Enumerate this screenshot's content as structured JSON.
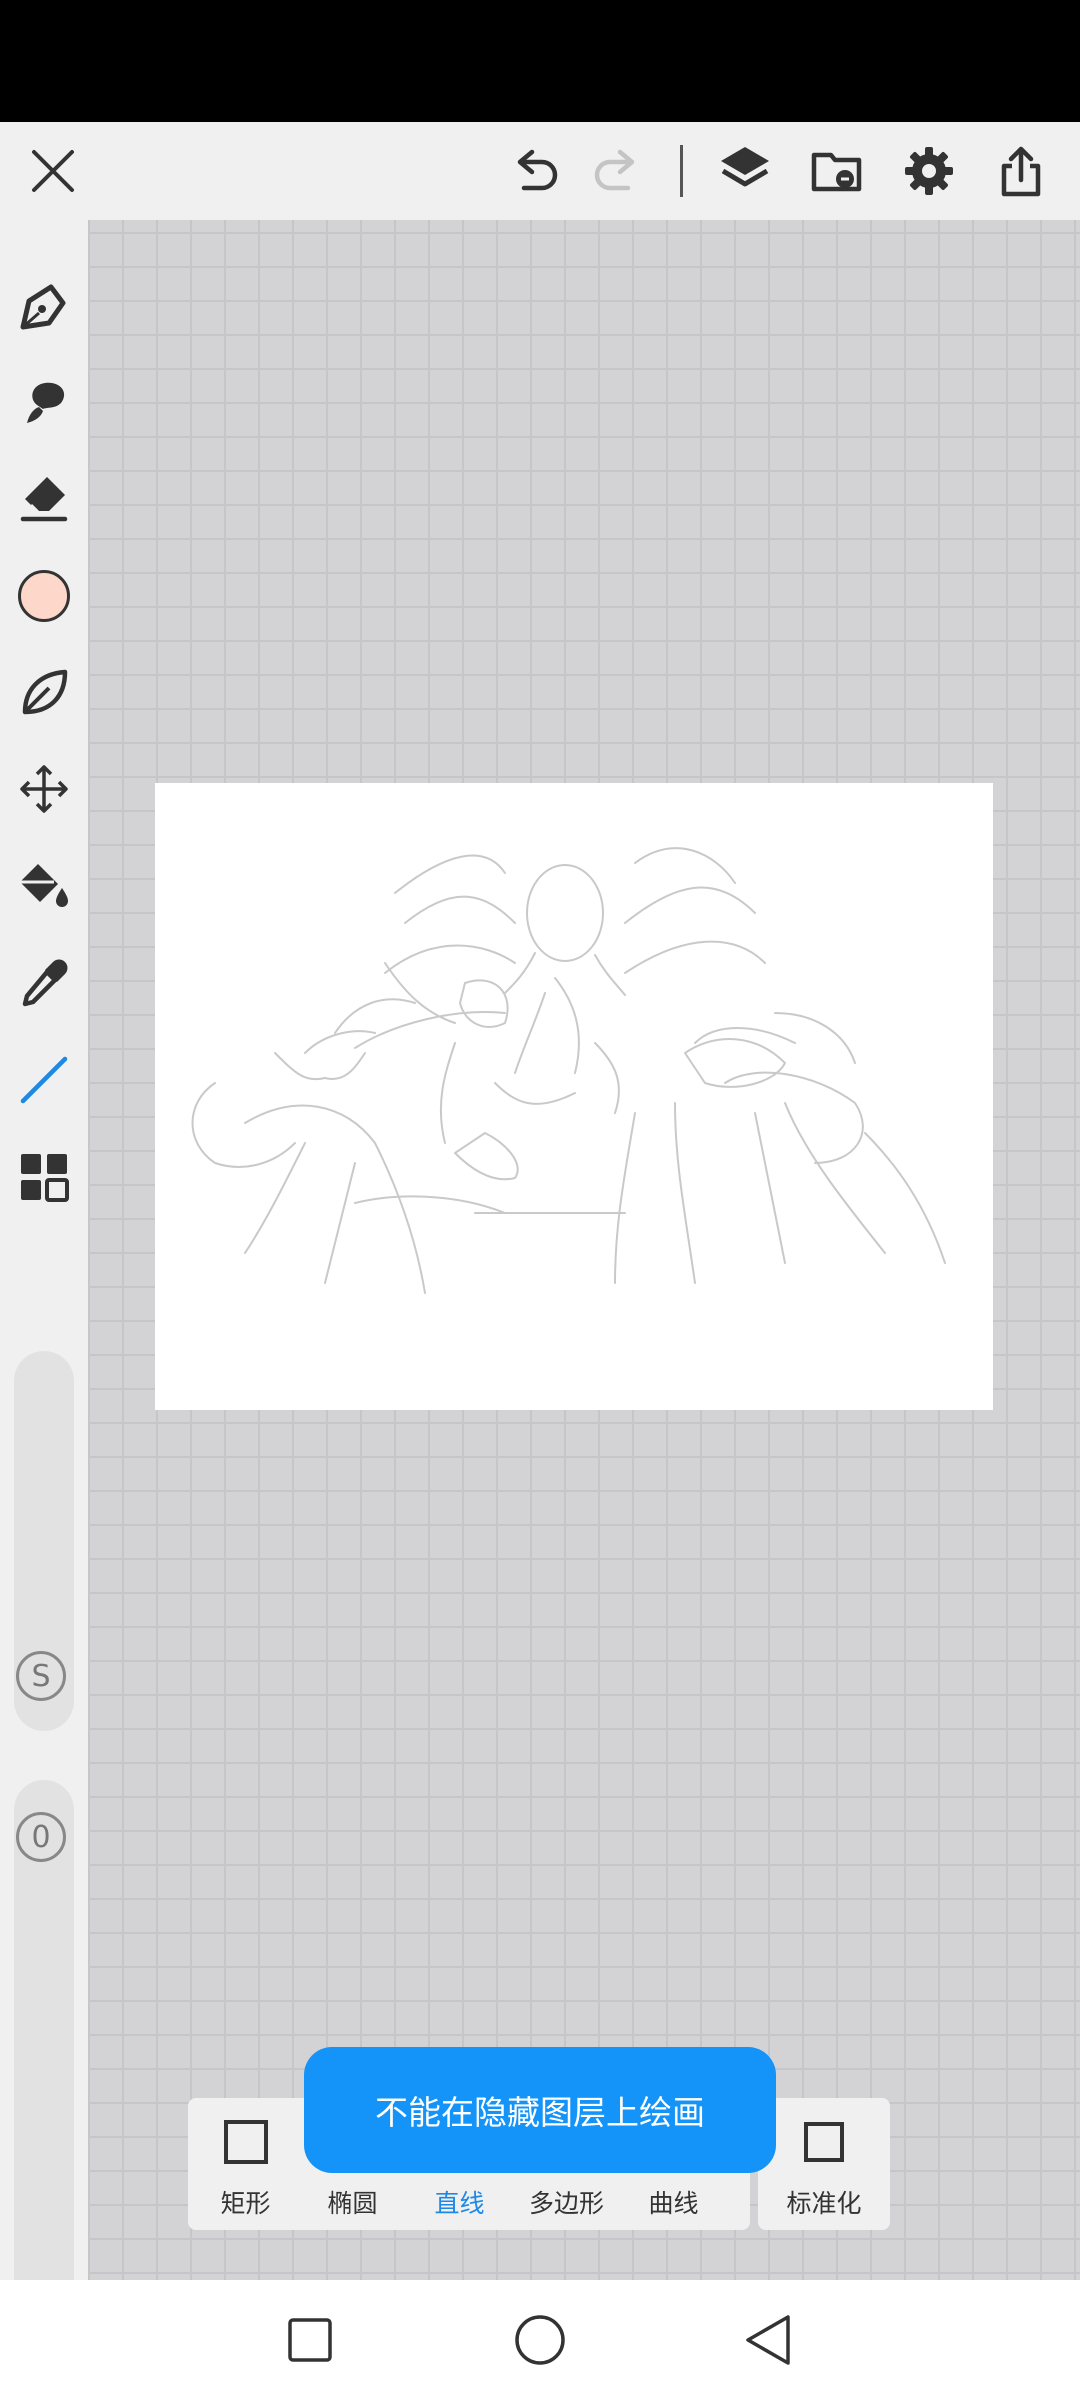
{
  "icons": {
    "close": "close-icon",
    "undo": "undo-icon",
    "redo": "redo-icon",
    "layers": "layers-icon",
    "folder": "folder-icon",
    "settings": "gear-icon",
    "share": "share-icon"
  },
  "colors": {
    "accent": "#1e88e5",
    "toast_bg": "#1493f8",
    "current_color": "#fdd7c9"
  },
  "left_toolbar": {
    "size_badge": "S",
    "opacity_badge": "0"
  },
  "shape_panel": {
    "items": [
      {
        "label": "矩形"
      },
      {
        "label": "椭圆"
      },
      {
        "label": "直线"
      },
      {
        "label": "多边形"
      },
      {
        "label": "曲线"
      }
    ],
    "active_index": 2,
    "normalize_label": "标准化"
  },
  "toast": {
    "message": "不能在隐藏图层上绘画"
  }
}
